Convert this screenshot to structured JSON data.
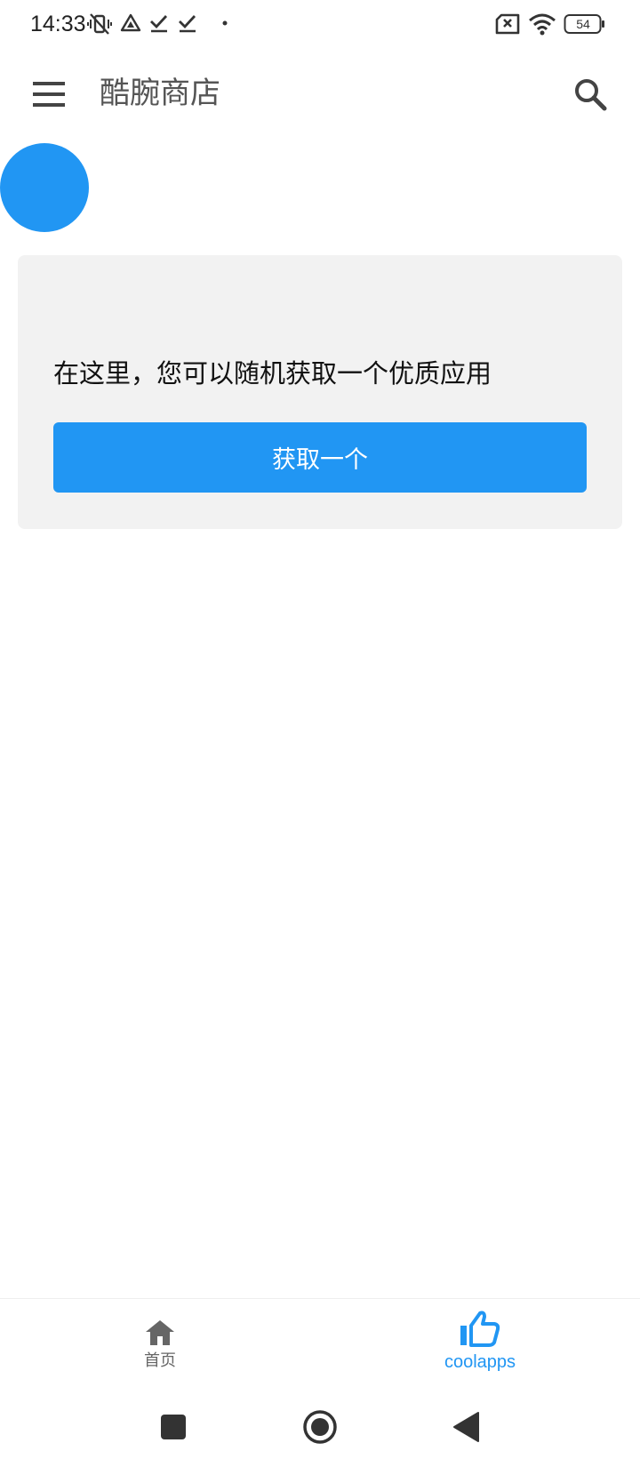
{
  "status_bar": {
    "time": "14:33",
    "battery_level": "54",
    "icons": [
      "vibrate-off-icon",
      "drive-icon",
      "check-icon",
      "check-icon",
      "dot-icon",
      "no-sim-icon",
      "wifi-icon",
      "battery-icon"
    ]
  },
  "app_bar": {
    "title": "酷腕商店",
    "menu_icon": "menu-icon",
    "search_icon": "search-icon"
  },
  "card": {
    "text": "在这里，您可以随机获取一个优质应用",
    "button_label": "获取一个"
  },
  "bottom_nav": {
    "items": [
      {
        "label": "首页",
        "icon": "home-icon",
        "active": false
      },
      {
        "label": "coolapps",
        "icon": "thumbs-up-icon",
        "active": true
      }
    ]
  },
  "colors": {
    "accent": "#2196f3",
    "card_bg": "#f2f2f2",
    "inactive": "#666666"
  }
}
